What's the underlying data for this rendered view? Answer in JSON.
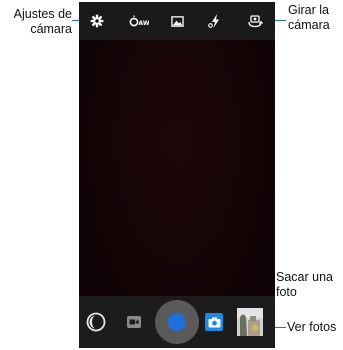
{
  "annotations": {
    "camera_settings": "Ajustes de cámara",
    "switch_camera": "Girar la cámara",
    "take_photo": "Sacar una foto",
    "view_photos": "Ver fotos"
  },
  "top_bar": {
    "icons": [
      "gear-icon",
      "white-balance-icon",
      "scene-mode-icon",
      "flash-icon",
      "switch-camera-icon"
    ],
    "white_balance_text": "AW"
  },
  "bottom_bar": {
    "icons": [
      "panorama-mode-icon",
      "video-mode-icon",
      "shutter-button",
      "photo-mode-icon",
      "gallery-thumbnail"
    ]
  },
  "colors": {
    "accent": "#1e6fd8",
    "viewfinder": "#140508",
    "bar": "#1a1a1a"
  }
}
